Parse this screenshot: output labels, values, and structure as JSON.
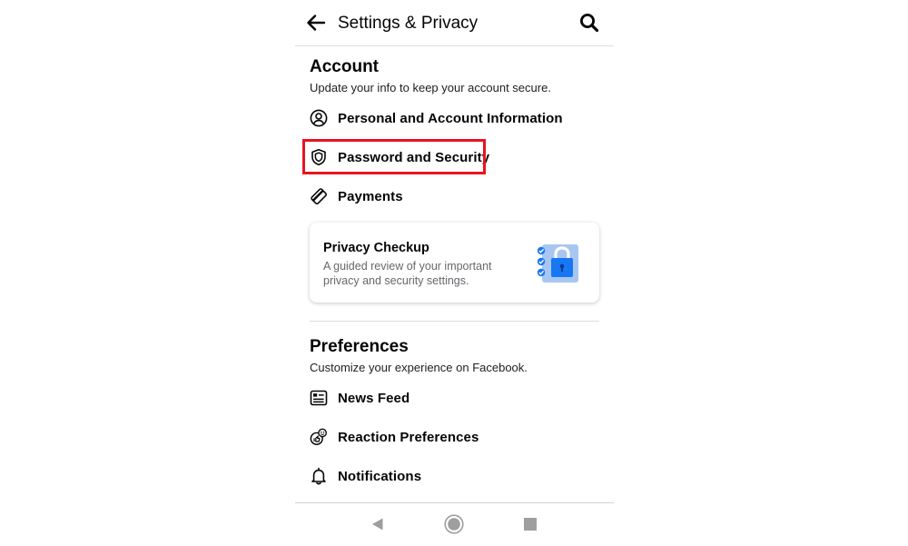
{
  "header": {
    "title": "Settings & Privacy",
    "back_icon": "arrow-left-icon",
    "search_icon": "search-icon"
  },
  "account": {
    "title": "Account",
    "description": "Update your info to keep your account secure.",
    "items": [
      {
        "label": "Personal and Account Information",
        "icon": "user-circle-icon"
      },
      {
        "label": "Password and Security",
        "icon": "shield-icon",
        "highlighted": true
      },
      {
        "label": "Payments",
        "icon": "payment-card-icon"
      }
    ]
  },
  "privacy_checkup": {
    "title": "Privacy Checkup",
    "description": "A guided review of your important privacy and security settings.",
    "icon": "lock-checklist-icon"
  },
  "preferences": {
    "title": "Preferences",
    "description": "Customize your experience on Facebook.",
    "items": [
      {
        "label": "News Feed",
        "icon": "news-feed-icon"
      },
      {
        "label": "Reaction Preferences",
        "icon": "reaction-icon"
      },
      {
        "label": "Notifications",
        "icon": "bell-icon"
      }
    ]
  },
  "system_nav": {
    "buttons": [
      "back-triangle-icon",
      "home-circle-icon",
      "recents-square-icon"
    ]
  },
  "colors": {
    "highlight": "#e8141e",
    "accent_blue": "#1877f2",
    "secondary_text": "#65676b",
    "divider": "#dadde1"
  }
}
